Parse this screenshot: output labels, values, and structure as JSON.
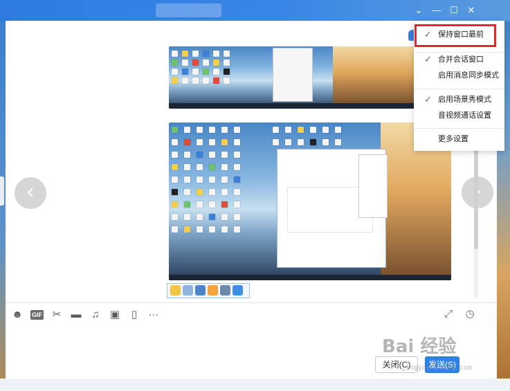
{
  "window": {
    "controls": [
      "⌄",
      "—",
      "☐",
      "✕"
    ]
  },
  "dropdown": {
    "items": [
      {
        "label": "保持窗口最前",
        "checked": true,
        "highlighted": true
      },
      {
        "label": "合并会话窗口",
        "checked": true
      },
      {
        "label": "启用消息同步模式",
        "checked": false
      },
      {
        "label": "启用场景秀模式",
        "checked": true
      },
      {
        "label": "音视频通话设置",
        "checked": false
      },
      {
        "label": "更多设置",
        "checked": false
      }
    ],
    "check_glyph": "✓"
  },
  "nav": {
    "prev_glyph": "‹",
    "next_glyph": "›"
  },
  "toolbar": {
    "icons": [
      "emoji-icon",
      "gif-icon",
      "scissors-icon",
      "folder-icon",
      "music-icon",
      "image-icon",
      "shake-icon",
      "more-icon"
    ],
    "gif_label": "GIF",
    "more_label": "···"
  },
  "buttons": {
    "close_label": "关闭(C)",
    "send_label": "发送(S)"
  },
  "watermark": {
    "text": "Bai 经验",
    "sub": "jingyan.baidu.com"
  },
  "colors": {
    "accent": "#2f82e8",
    "highlight": "#e5242b"
  }
}
